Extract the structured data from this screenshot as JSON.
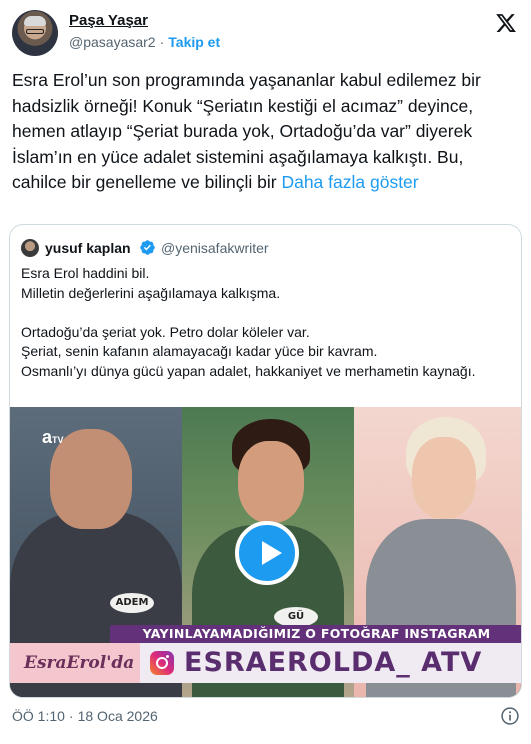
{
  "author": {
    "name": "Paşa Yaşar",
    "handle": "@pasayasar2",
    "dot": "·",
    "follow_label": "Takip et"
  },
  "icons": {
    "logo": "x-logo-icon",
    "verified": "verified-badge-icon",
    "play": "play-icon",
    "info": "info-icon",
    "instagram": "instagram-icon"
  },
  "colors": {
    "accent": "#1d9bf0",
    "text": "#0f1419",
    "muted": "#536471",
    "border": "#cfd9de"
  },
  "tweet": {
    "text": "Esra Erol’un son programında yaşananlar kabul edilemez bir hadsizlik örneği! Konuk “Şeriatın kestiği el acımaz” deyince, hemen atlayıp “Şeriat burada yok, Ortadoğu’da var” diyerek İslam’ın en yüce adalet sistemini aşağılamaya kalkıştı. Bu, cahilce bir genelleme ve bilinçli bir",
    "show_more": "Daha fazla göster"
  },
  "quoted": {
    "name": "yusuf kaplan",
    "handle": "@yenisafakwriter",
    "lines": [
      "Esra Erol haddini bil.",
      "Milletin değerlerini aşağılamaya kalkışma.",
      "",
      "Ortadoğu’da şeriat yok. Petro dolar köleler var.",
      "Şeriat, senin kafanın alamayacağı kadar yüce bir kavram.",
      "Osmanlı’yı dünya gücü yapan adalet, hakkaniyet ve merhametin kaynağı."
    ],
    "media": {
      "channel": "a",
      "channel_suffix": "TV",
      "badge_left": "ADEM",
      "badge_mid": "GÜ",
      "banner_top": "YAYINLAYAMADIĞIMIZ O FOTOĞRAF INSTAGRAM ADRESİMİZDE",
      "banner_show": "EsraErol'da",
      "banner_handle": "ESRAEROLDA_ ATV"
    }
  },
  "footer": {
    "time": "ÖÖ 1:10",
    "sep": "·",
    "date": "18 Oca 2026"
  }
}
